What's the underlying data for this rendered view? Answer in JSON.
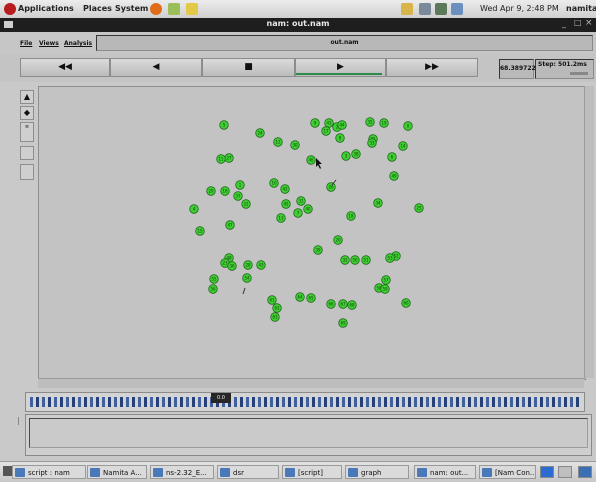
{
  "top_panel": {
    "menus": [
      "Applications",
      "Places",
      "System"
    ],
    "clock": "Wed Apr 9,  2:48 PM",
    "user": "namita"
  },
  "window": {
    "title": "nam: out.nam",
    "minimize": "_",
    "maximize": "□",
    "close": "×"
  },
  "menu": {
    "file": "File",
    "views": "Views",
    "analysis": "Analysis"
  },
  "file_name": "out.nam",
  "transport": {
    "rewind": "◀◀",
    "back": "◀",
    "stop": "■",
    "play": "▶",
    "forward": "▶▶",
    "time": "68.389722",
    "step": "Step: 501.2ms"
  },
  "timeline_marker": "0.0",
  "taskbar": [
    {
      "label": "script : nam"
    },
    {
      "label": "Namita A..."
    },
    {
      "label": "ns-2.32_E..."
    },
    {
      "label": "dsr"
    },
    {
      "label": "[script]"
    },
    {
      "label": "graph"
    },
    {
      "label": "nam: out..."
    },
    {
      "label": "[Nam Con..."
    }
  ],
  "node_color": "#3fcf33",
  "nodes": [
    {
      "id": "5"
    },
    {
      "id": "24"
    },
    {
      "id": "12"
    },
    {
      "id": "30"
    },
    {
      "id": "9"
    },
    {
      "id": "41"
    },
    {
      "id": "2"
    },
    {
      "id": "17"
    },
    {
      "id": "44"
    },
    {
      "id": "8"
    },
    {
      "id": "35"
    },
    {
      "id": "19"
    },
    {
      "id": "0"
    },
    {
      "id": "27"
    },
    {
      "id": "11"
    },
    {
      "id": "46"
    },
    {
      "id": "3"
    },
    {
      "id": "38"
    },
    {
      "id": "21"
    },
    {
      "id": "14"
    },
    {
      "id": "33"
    },
    {
      "id": "6"
    },
    {
      "id": "49"
    },
    {
      "id": "26"
    },
    {
      "id": "10"
    },
    {
      "id": "42"
    },
    {
      "id": "1"
    },
    {
      "id": "29"
    },
    {
      "id": "16"
    },
    {
      "id": "37"
    },
    {
      "id": "22"
    },
    {
      "id": "4"
    },
    {
      "id": "45"
    },
    {
      "id": "13"
    },
    {
      "id": "31"
    },
    {
      "id": "7"
    },
    {
      "id": "40"
    },
    {
      "id": "18"
    },
    {
      "id": "34"
    },
    {
      "id": "25"
    },
    {
      "id": "47"
    },
    {
      "id": "15"
    },
    {
      "id": "39"
    },
    {
      "id": "20"
    },
    {
      "id": "32"
    },
    {
      "id": "48"
    },
    {
      "id": "23"
    },
    {
      "id": "36"
    },
    {
      "id": "28"
    },
    {
      "id": "43"
    },
    {
      "id": "50"
    },
    {
      "id": "51"
    },
    {
      "id": "52"
    },
    {
      "id": "53"
    },
    {
      "id": "54"
    },
    {
      "id": "55"
    },
    {
      "id": "56"
    },
    {
      "id": "57"
    },
    {
      "id": "58"
    },
    {
      "id": "59"
    },
    {
      "id": "60"
    },
    {
      "id": "61"
    },
    {
      "id": "62"
    },
    {
      "id": "63"
    },
    {
      "id": "64"
    },
    {
      "id": "65"
    },
    {
      "id": "66"
    },
    {
      "id": "67"
    },
    {
      "id": "68"
    },
    {
      "id": "69"
    }
  ]
}
